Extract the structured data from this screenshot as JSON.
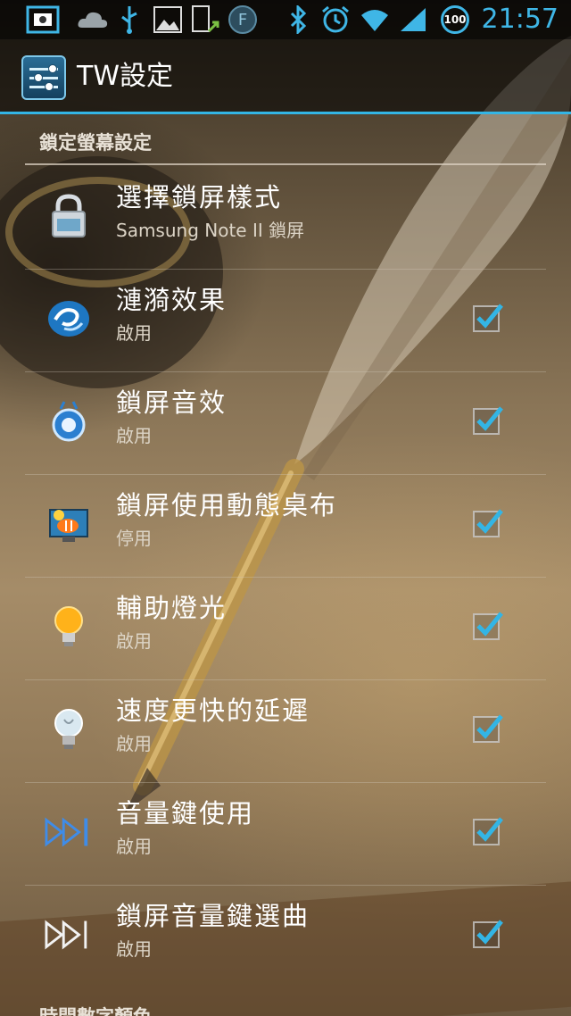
{
  "status_bar": {
    "time": "21:57",
    "battery_level": "100",
    "f_badge": "F",
    "icons": [
      "screenshot-icon",
      "cloud-icon",
      "usb-icon",
      "image-icon",
      "app-update-icon",
      "f-app-icon",
      "bluetooth-icon",
      "alarm-icon",
      "wifi-icon",
      "signal-icon",
      "battery-icon"
    ]
  },
  "action_bar": {
    "title": "TW設定",
    "icon": "settings-sliders-icon"
  },
  "section": {
    "title": "鎖定螢幕設定"
  },
  "items": [
    {
      "title": "選擇鎖屏樣式",
      "summary": "Samsung Note II 鎖屏",
      "icon": "lock-icon",
      "has_checkbox": false
    },
    {
      "title": "漣漪效果",
      "summary": "啟用",
      "icon": "ripple-icon",
      "checked": true
    },
    {
      "title": "鎖屏音效",
      "summary": "啟用",
      "icon": "sound-icon",
      "checked": true
    },
    {
      "title": "鎖屏使用動態桌布",
      "summary": "停用",
      "icon": "live-wallpaper-icon",
      "checked": true
    },
    {
      "title": "輔助燈光",
      "summary": "啟用",
      "icon": "light-bulb-icon",
      "checked": true
    },
    {
      "title": "速度更快的延遲",
      "summary": "啟用",
      "icon": "bulb-off-icon",
      "checked": true
    },
    {
      "title": "音量鍵使用",
      "summary": "啟用",
      "icon": "fast-forward-icon",
      "checked": true
    },
    {
      "title": "鎖屏音量鍵選曲",
      "summary": "啟用",
      "icon": "skip-next-icon",
      "checked": true
    }
  ],
  "next_section": {
    "title": "時間數字顏色"
  },
  "colors": {
    "accent": "#33b5e5",
    "status_icons": "#3fb6e6",
    "check": "#33b5e5"
  }
}
